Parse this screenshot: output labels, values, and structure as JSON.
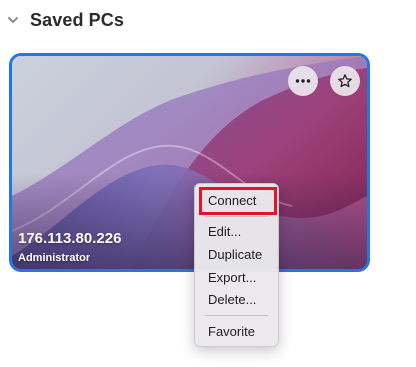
{
  "section": {
    "title": "Saved PCs",
    "chevron_icon": "chevron-down-icon"
  },
  "card": {
    "pc_name": "176.113.80.226",
    "username": "Administrator",
    "more_icon": "ellipsis-icon",
    "favorite_icon": "star-icon",
    "border_color": "#2277e8"
  },
  "context_menu": {
    "items": [
      {
        "label": "Connect"
      },
      {
        "label": "Edit..."
      },
      {
        "label": "Duplicate"
      },
      {
        "label": "Export..."
      },
      {
        "label": "Delete..."
      },
      {
        "label": "Favorite"
      }
    ],
    "highlight_color": "#e5122b"
  }
}
